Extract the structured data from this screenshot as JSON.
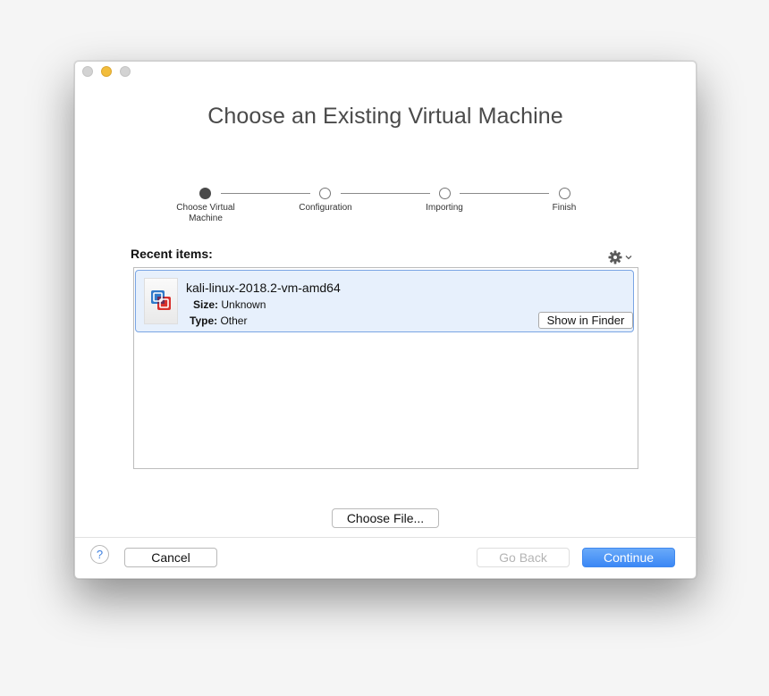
{
  "window": {
    "title": "Choose an Existing Virtual Machine"
  },
  "steps": [
    {
      "label": "Choose Virtual\nMachine",
      "active": true
    },
    {
      "label": "Configuration",
      "active": false
    },
    {
      "label": "Importing",
      "active": false
    },
    {
      "label": "Finish",
      "active": false
    }
  ],
  "recent": {
    "label": "Recent items:",
    "gear_icon": "gear-icon",
    "items": [
      {
        "name": "kali-linux-2018.2-vm-amd64",
        "size_label": "Size:",
        "size_value": "Unknown",
        "type_label": "Type:",
        "type_value": "Other",
        "show_in_finder": "Show in Finder"
      }
    ]
  },
  "choose_file_label": "Choose File...",
  "footer": {
    "help": "?",
    "cancel": "Cancel",
    "go_back": "Go Back",
    "continue": "Continue"
  },
  "colors": {
    "accent": "#3b87f5",
    "selection_bg": "#e7f0fc",
    "selection_border": "#7aa5e4",
    "minimize_light": "#f2bd3c"
  }
}
